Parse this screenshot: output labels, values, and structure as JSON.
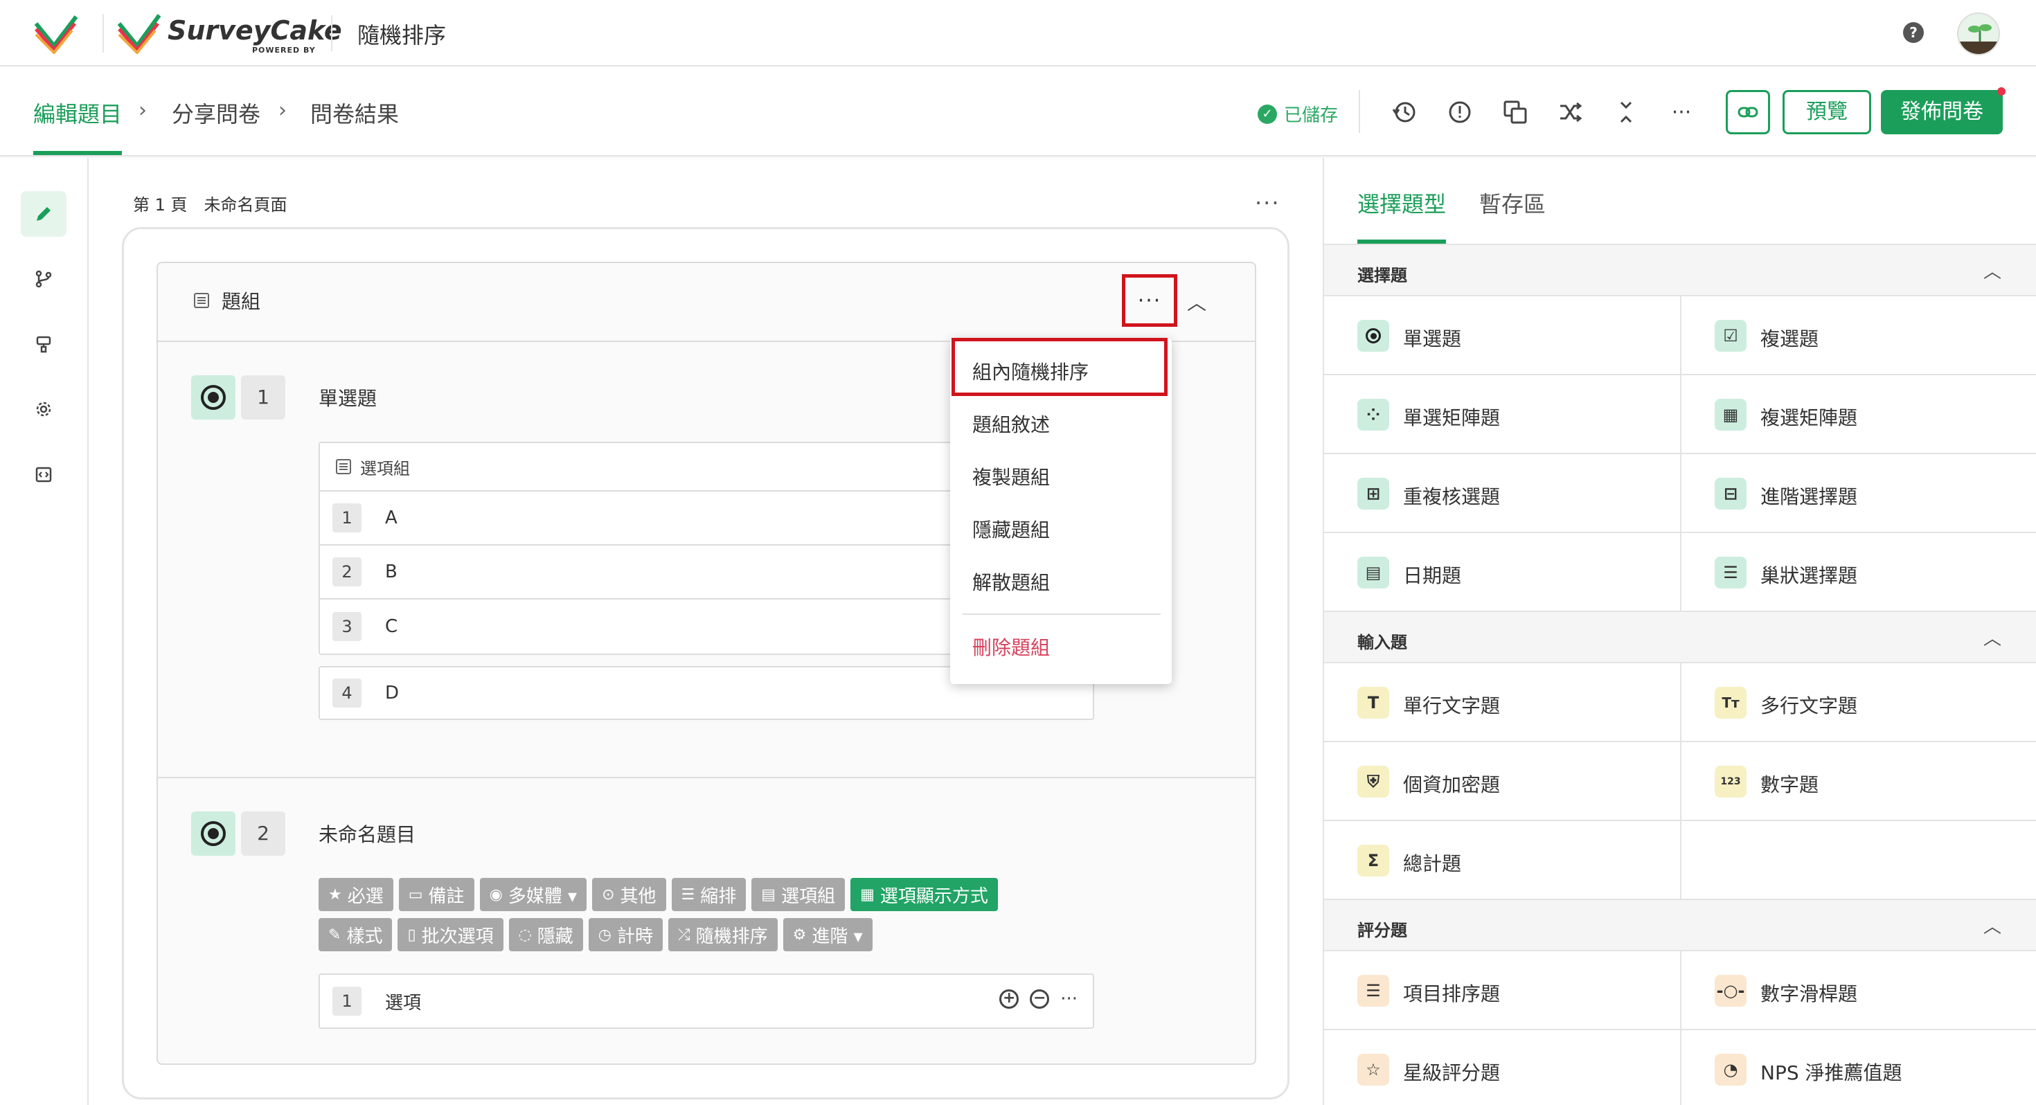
{
  "brand": {
    "name": "SurveyCake",
    "powered_by": "POWERED BY"
  },
  "survey_title": "隨機排序",
  "breadcrumb": [
    {
      "label": "編輯題目",
      "active": true
    },
    {
      "label": "分享問卷",
      "active": false
    },
    {
      "label": "問卷結果",
      "active": false
    }
  ],
  "toolbar": {
    "saved_status": "已儲存",
    "icons": [
      "history-icon",
      "warning-icon",
      "copy-icon",
      "shuffle-icon",
      "collapse-icon",
      "more-icon"
    ],
    "preview_label": "預覽",
    "publish_label": "發佈問卷"
  },
  "rail": [
    "edit-icon",
    "branch-icon",
    "paint-roller-icon",
    "settings-icon",
    "code-icon"
  ],
  "page": {
    "label": "第 1 頁　未命名頁面"
  },
  "group": {
    "title": "題組"
  },
  "question1": {
    "number": "1",
    "title": "單選題",
    "option_group_label": "選項組",
    "options": [
      {
        "idx": "1",
        "text": "A"
      },
      {
        "idx": "2",
        "text": "B"
      },
      {
        "idx": "3",
        "text": "C"
      }
    ],
    "extra_option": {
      "idx": "4",
      "text": "D"
    }
  },
  "question2": {
    "number": "2",
    "title": "未命名題目",
    "chips_row1": [
      {
        "icon": "★",
        "label": "必選"
      },
      {
        "icon": "▭",
        "label": "備註"
      },
      {
        "icon": "◉",
        "label": "多媒體 ▾"
      },
      {
        "icon": "⊙",
        "label": "其他"
      },
      {
        "icon": "☰",
        "label": "縮排"
      },
      {
        "icon": "▤",
        "label": "選項組"
      },
      {
        "icon": "▦",
        "label": "選項顯示方式",
        "active": true
      }
    ],
    "chips_row2": [
      {
        "icon": "✎",
        "label": "樣式"
      },
      {
        "icon": "▯",
        "label": "批次選項"
      },
      {
        "icon": "◌",
        "label": "隱藏"
      },
      {
        "icon": "◷",
        "label": "計時"
      },
      {
        "icon": "⤮",
        "label": "隨機排序"
      },
      {
        "icon": "⚙",
        "label": "進階 ▾"
      }
    ],
    "option": {
      "idx": "1",
      "text": "選項"
    }
  },
  "dropdown": {
    "items": [
      "組內隨機排序",
      "題組敘述",
      "複製題組",
      "隱藏題組",
      "解散題組"
    ],
    "danger": "刪除題組"
  },
  "right_panel": {
    "tabs": [
      "選擇題型",
      "暫存區"
    ],
    "sections": [
      {
        "title": "選擇題",
        "items": [
          {
            "label": "單選題",
            "icon": "radio-icon"
          },
          {
            "label": "複選題",
            "icon": "checkbox-icon"
          },
          {
            "label": "單選矩陣題",
            "icon": "matrix-radio-icon"
          },
          {
            "label": "複選矩陣題",
            "icon": "matrix-check-icon"
          },
          {
            "label": "重複核選題",
            "icon": "repeat-check-icon"
          },
          {
            "label": "進階選擇題",
            "icon": "advanced-choice-icon"
          },
          {
            "label": "日期題",
            "icon": "calendar-icon"
          },
          {
            "label": "巢狀選擇題",
            "icon": "nested-choice-icon"
          }
        ]
      },
      {
        "title": "輸入題",
        "items": [
          {
            "label": "單行文字題",
            "icon": "text-icon"
          },
          {
            "label": "多行文字題",
            "icon": "multiline-text-icon"
          },
          {
            "label": "個資加密題",
            "icon": "privacy-lock-icon"
          },
          {
            "label": "數字題",
            "icon": "number-icon"
          },
          {
            "label": "總計題",
            "icon": "sum-icon"
          }
        ]
      },
      {
        "title": "評分題",
        "items": [
          {
            "label": "項目排序題",
            "icon": "ranking-icon"
          },
          {
            "label": "數字滑桿題",
            "icon": "slider-icon"
          },
          {
            "label": "星級評分題",
            "icon": "star-icon"
          },
          {
            "label": "NPS 淨推薦值題",
            "icon": "nps-icon"
          }
        ]
      }
    ]
  },
  "colors": {
    "brand_green": "#1b9e5a",
    "danger_red": "#d0141c"
  }
}
